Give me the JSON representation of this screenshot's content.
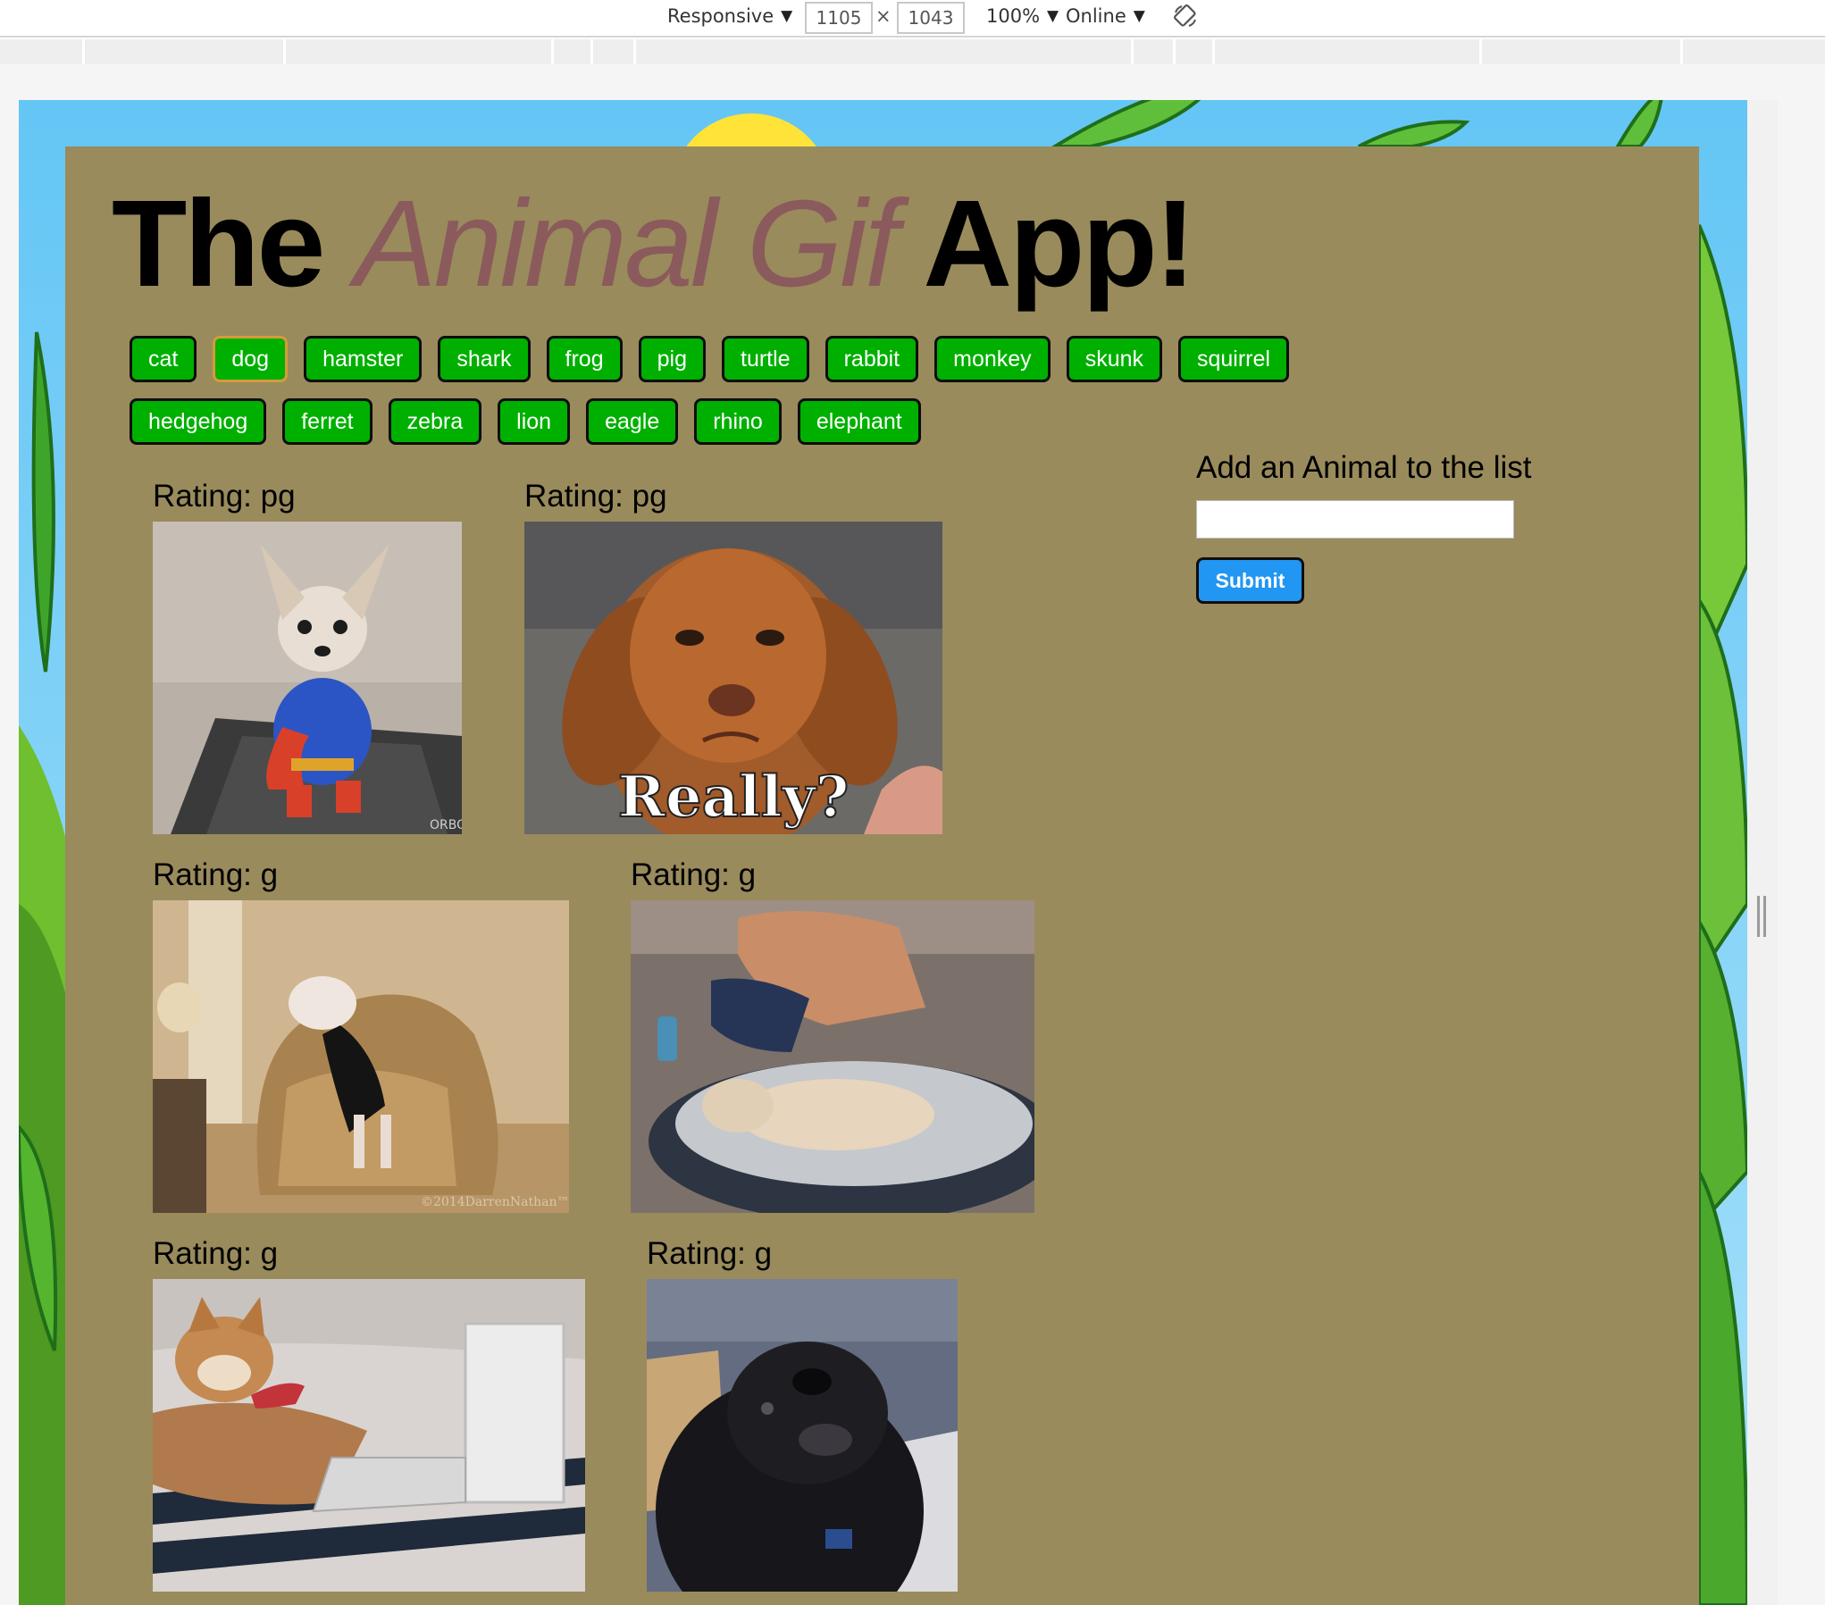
{
  "devtools": {
    "device": "Responsive",
    "width": "1105",
    "height": "1043",
    "zoom": "100%",
    "network": "Online",
    "rotate_icon": "rotate-icon"
  },
  "app": {
    "title_part1": "The",
    "title_accent": "Animal Gif",
    "title_part2": "App!",
    "colors": {
      "panel": "#998b5c",
      "button": "#00b000",
      "accent": "#8b5a5c",
      "submit": "#2196f3"
    }
  },
  "buttons_row1": [
    "cat",
    "dog",
    "hamster",
    "shark",
    "frog",
    "pig",
    "turtle",
    "rabbit",
    "monkey",
    "skunk",
    "squirrel"
  ],
  "buttons_row2": [
    "hedgehog",
    "ferret",
    "zebra",
    "lion",
    "eagle",
    "rhino",
    "elephant"
  ],
  "add_form": {
    "title": "Add an Animal to the list",
    "input_value": "",
    "submit_label": "Submit"
  },
  "gifs": [
    {
      "rating": "Rating: pg",
      "caption": "",
      "watermark": "ORBO"
    },
    {
      "rating": "Rating: pg",
      "caption": "Really?",
      "watermark": ""
    },
    {
      "rating": "Rating: g",
      "caption": "",
      "watermark": "©2014DarrenNathan™"
    },
    {
      "rating": "Rating: g",
      "caption": "",
      "watermark": ""
    },
    {
      "rating": "Rating: g",
      "caption": "",
      "watermark": ""
    },
    {
      "rating": "Rating: g",
      "caption": "",
      "watermark": ""
    }
  ]
}
